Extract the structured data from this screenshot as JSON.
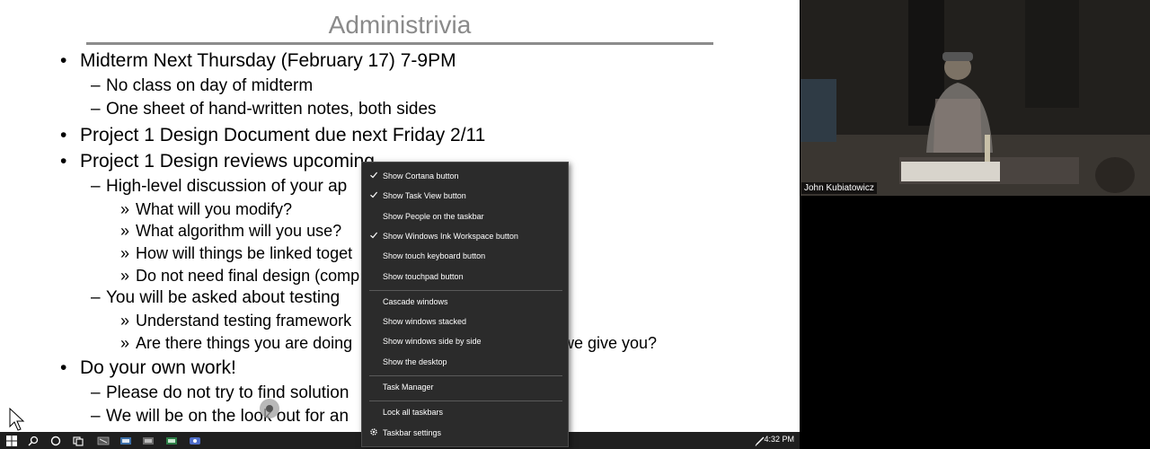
{
  "slide": {
    "title": "Administrivia",
    "lines": [
      {
        "level": 1,
        "bullet": "•",
        "text": "Midterm Next Thursday (February 17) 7-9PM"
      },
      {
        "level": 2,
        "bullet": "–",
        "text": "No class on day of midterm"
      },
      {
        "level": 2,
        "bullet": "–",
        "text": "One sheet of hand-written notes, both sides"
      },
      {
        "level": 1,
        "bullet": "•",
        "text": "Project 1 Design Document due next Friday 2/11"
      },
      {
        "level": 1,
        "bullet": "•",
        "text": "Project 1 Design reviews upcoming"
      },
      {
        "level": 2,
        "bullet": "–",
        "text": "High-level discussion of your ap"
      },
      {
        "level": 3,
        "bullet": "»",
        "text": "What will you modify?"
      },
      {
        "level": 3,
        "bullet": "»",
        "text": "What algorithm will you use?"
      },
      {
        "level": 3,
        "bullet": "»",
        "text": "How will things be linked toget"
      },
      {
        "level": 3,
        "bullet": "»",
        "text": "Do not need final design (comp"
      },
      {
        "level": 2,
        "bullet": "–",
        "text": "You will be asked about testing"
      },
      {
        "level": 3,
        "bullet": "»",
        "text": "Understand testing framework"
      },
      {
        "level": 3,
        "bullet": "»",
        "text": "Are there things you are doing"
      },
      {
        "level": 1,
        "bullet": "•",
        "text": "Do your own work!"
      },
      {
        "level": 2,
        "bullet": "–",
        "text": "Please do not try to find solution"
      },
      {
        "level": 2,
        "bullet": "–",
        "text": "We will be on the look out for an"
      }
    ],
    "trailing_fragment": "we give you?"
  },
  "video": {
    "speaker_name": "John Kubiatowicz"
  },
  "context_menu": {
    "items": [
      {
        "label": "Show Cortana button",
        "checked": true
      },
      {
        "label": "Show Task View button",
        "checked": true
      },
      {
        "label": "Show People on the taskbar",
        "checked": false
      },
      {
        "label": "Show Windows Ink Workspace button",
        "checked": true
      },
      {
        "label": "Show touch keyboard button",
        "checked": false
      },
      {
        "label": "Show touchpad button",
        "checked": false
      },
      {
        "separator": true
      },
      {
        "label": "Cascade windows",
        "checked": false
      },
      {
        "label": "Show windows stacked",
        "checked": false
      },
      {
        "label": "Show windows side by side",
        "checked": false
      },
      {
        "label": "Show the desktop",
        "checked": false
      },
      {
        "separator": true
      },
      {
        "label": "Task Manager",
        "checked": false
      },
      {
        "separator": true
      },
      {
        "label": "Lock all taskbars",
        "checked": false
      },
      {
        "label": "Taskbar settings",
        "checked": false,
        "icon": "gear-icon"
      }
    ]
  },
  "taskbar": {
    "clock": "4:32 PM",
    "icons": [
      "windows-start-icon",
      "search-icon",
      "cortana-icon",
      "task-view-icon",
      "app-icon-1",
      "app-icon-2",
      "app-icon-3",
      "app-icon-4",
      "app-icon-5"
    ],
    "tray_icons": [
      "pen-icon"
    ],
    "accent_color": "#1f1f1f"
  },
  "colors": {
    "slide_title": "#8a8a8a",
    "menu_bg": "#2b2b2b",
    "menu_text": "#ffffff"
  }
}
